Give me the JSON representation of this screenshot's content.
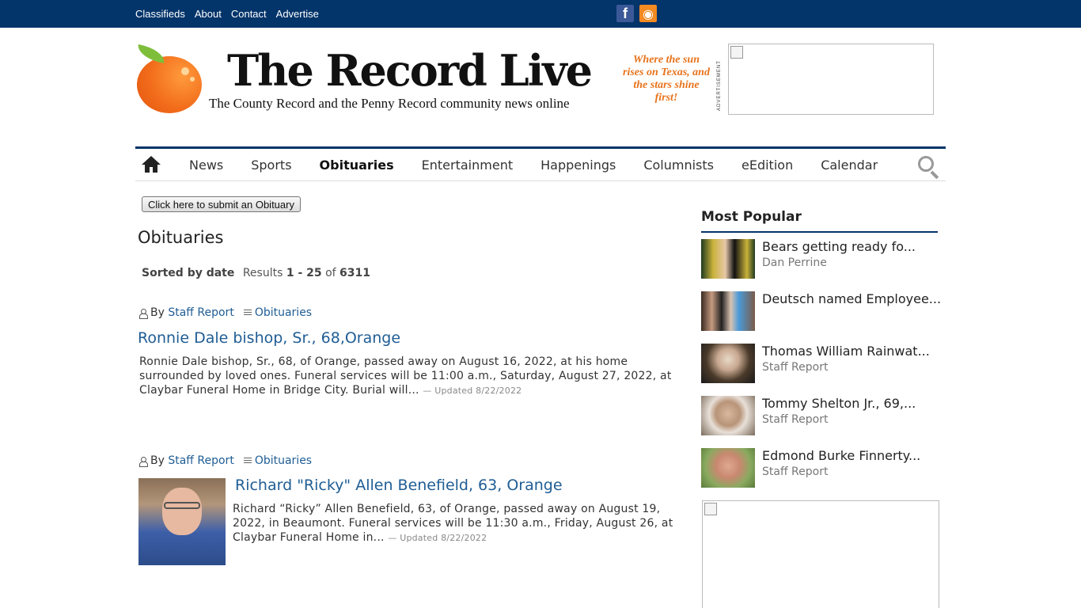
{
  "topbar": {
    "links": [
      "Classifieds",
      "About",
      "Contact",
      "Advertise"
    ],
    "social": [
      {
        "name": "facebook-icon",
        "glyph": "f",
        "color": "#3b5998"
      },
      {
        "name": "rss-icon",
        "glyph": "◉",
        "color": "#f48a21"
      }
    ],
    "bg_color": "#03346a"
  },
  "header": {
    "title": "The Record Live",
    "subtitle": "The County Record and the Penny Record community news online",
    "tagline": "Where the sun rises on Texas, and the stars shine first!",
    "ad_label": "ADVERTISEMENT"
  },
  "nav": {
    "items": [
      "News",
      "Sports",
      "Obituaries",
      "Entertainment",
      "Happenings",
      "Columnists",
      "eEdition",
      "Calendar"
    ],
    "active": "Obituaries"
  },
  "main": {
    "submit_button": "Click here to submit an Obituary",
    "page_title": "Obituaries",
    "sorted_label": "Sorted by date",
    "results_label": "Results",
    "range_start": "1",
    "range_sep": " - ",
    "range_end": "25",
    "of_label": "of",
    "total": "6311",
    "articles": [
      {
        "by_label": "By",
        "author": "Staff Report",
        "category": "Obituaries",
        "title": "Ronnie Dale bishop, Sr., 68,Orange",
        "summary": "Ronnie Dale bishop, Sr., 68, of Orange, passed away on August 16, 2022, at his home surrounded by loved ones. Funeral services will be 11:00 a.m., Saturday, August 27, 2022, at Claybar Funeral Home in Bridge City. Burial will...",
        "updated": "— Updated 8/22/2022"
      },
      {
        "by_label": "By",
        "author": "Staff Report",
        "category": "Obituaries",
        "title": "Richard \"Ricky\" Allen Benefield, 63, Orange",
        "summary": "Richard “Ricky” Allen Benefield, 63, of Orange, passed away on August 19, 2022, in Beaumont. Funeral services will be 11:30 a.m., Friday, August 26, at Claybar Funeral Home in...",
        "updated": "— Updated 8/22/2022"
      }
    ]
  },
  "sidebar": {
    "title": "Most Popular",
    "items": [
      {
        "title": "Bears getting ready fo...",
        "author": "Dan Perrine"
      },
      {
        "title": "Deutsch named Employee...",
        "author": ""
      },
      {
        "title": "Thomas William Rainwat...",
        "author": "Staff Report"
      },
      {
        "title": "Tommy Shelton Jr., 69,...",
        "author": "Staff Report"
      },
      {
        "title": "Edmond Burke Finnerty...",
        "author": "Staff Report"
      }
    ]
  },
  "colors": {
    "accent_navy": "#03346a",
    "link_blue": "#1f5d94",
    "tagline_orange": "#e8731c"
  }
}
